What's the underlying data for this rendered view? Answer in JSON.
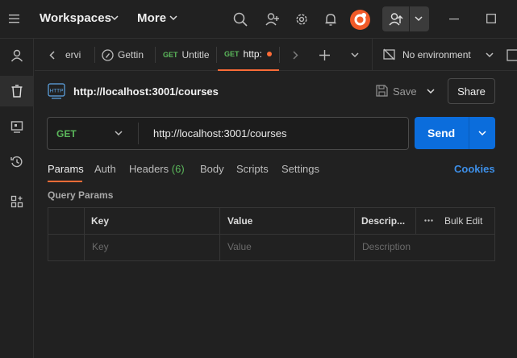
{
  "topbar": {
    "workspaces_label": "Workspaces",
    "more_label": "More"
  },
  "tabs": [
    {
      "label": "ervi",
      "method": ""
    },
    {
      "label": "Gettin",
      "method": ""
    },
    {
      "label": "Untitle",
      "method": "GET"
    },
    {
      "label": "http:",
      "method": "GET"
    }
  ],
  "environment": {
    "label": "No environment"
  },
  "request": {
    "title": "http://localhost:3001/courses",
    "save_label": "Save",
    "share_label": "Share",
    "method": "GET",
    "url": "http://localhost:3001/courses",
    "send_label": "Send"
  },
  "subtabs": {
    "params": "Params",
    "auth": "Auth",
    "headers": "Headers",
    "headers_count": "(6)",
    "body": "Body",
    "scripts": "Scripts",
    "settings": "Settings",
    "cookies": "Cookies"
  },
  "query_params": {
    "section_label": "Query Params",
    "columns": {
      "key": "Key",
      "value": "Value",
      "description": "Descrip...",
      "bulk_edit": "Bulk Edit"
    },
    "placeholders": {
      "key": "Key",
      "value": "Value",
      "description": "Description"
    }
  },
  "colors": {
    "accent": "#ff6c37",
    "send": "#0b6ddc",
    "get_method": "#5bb75b",
    "link": "#3d8fe8"
  }
}
